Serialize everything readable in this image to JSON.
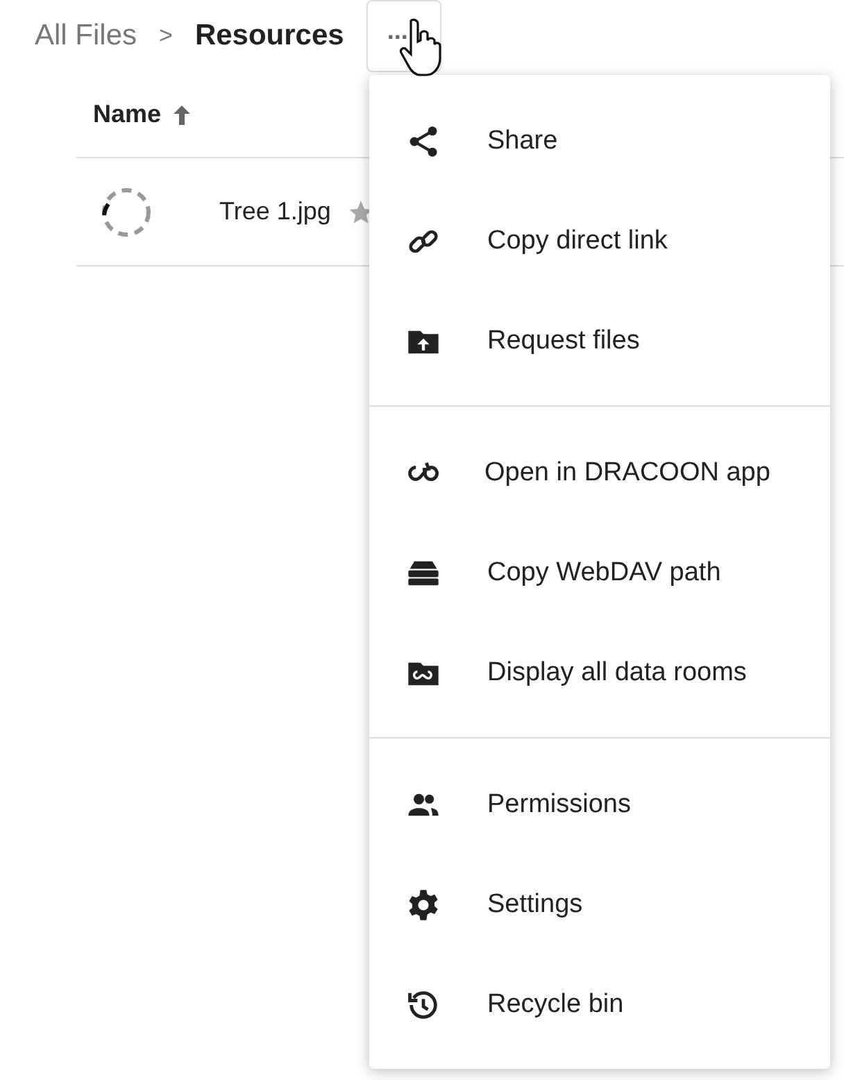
{
  "breadcrumb": [
    {
      "label": "All Files",
      "current": false
    },
    {
      "label": "Resources",
      "current": true
    }
  ],
  "breadcrumb_separator": ">",
  "more_button": {
    "label": "..."
  },
  "table": {
    "columns": [
      {
        "label": "Name",
        "sort_ascending": true
      }
    ],
    "rows": [
      {
        "name": "Tree 1.jpg",
        "favorite": false,
        "loading": true
      }
    ]
  },
  "menu": {
    "groups": [
      {
        "items": [
          {
            "kind": "share",
            "label": "Share"
          },
          {
            "kind": "link",
            "label": "Copy direct link"
          },
          {
            "kind": "upload-folder",
            "label": "Request files"
          }
        ]
      },
      {
        "items": [
          {
            "kind": "app",
            "label": "Open in DRACOON app"
          },
          {
            "kind": "server",
            "label": "Copy WebDAV path"
          },
          {
            "kind": "rooms",
            "label": "Display all data rooms"
          }
        ]
      },
      {
        "items": [
          {
            "kind": "people",
            "label": "Permissions"
          },
          {
            "kind": "gear",
            "label": "Settings"
          },
          {
            "kind": "history",
            "label": "Recycle bin"
          }
        ]
      }
    ]
  }
}
